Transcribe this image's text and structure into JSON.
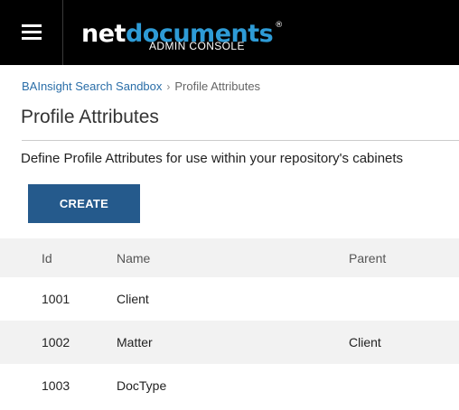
{
  "header": {
    "menu_icon": "hamburger-menu-icon",
    "brand_net": "net",
    "brand_docs": "documents",
    "brand_reg": "®",
    "brand_sub": "ADMIN CONSOLE"
  },
  "breadcrumb": {
    "parent": "BAInsight Search Sandbox",
    "separator": "›",
    "current": "Profile Attributes"
  },
  "page": {
    "title": "Profile Attributes",
    "description": "Define Profile Attributes for use within your repository's cabinets",
    "create_label": "CREATE"
  },
  "table": {
    "columns": [
      "Id",
      "Name",
      "Parent"
    ],
    "rows": [
      {
        "id": "1001",
        "name": "Client",
        "parent": ""
      },
      {
        "id": "1002",
        "name": "Matter",
        "parent": "Client"
      },
      {
        "id": "1003",
        "name": "DocType",
        "parent": ""
      }
    ]
  },
  "colors": {
    "topbar": "#000000",
    "brand_accent": "#2e9bd6",
    "button": "#255a8c",
    "link": "#2a6ea8",
    "alt_row": "#f2f2f2"
  }
}
